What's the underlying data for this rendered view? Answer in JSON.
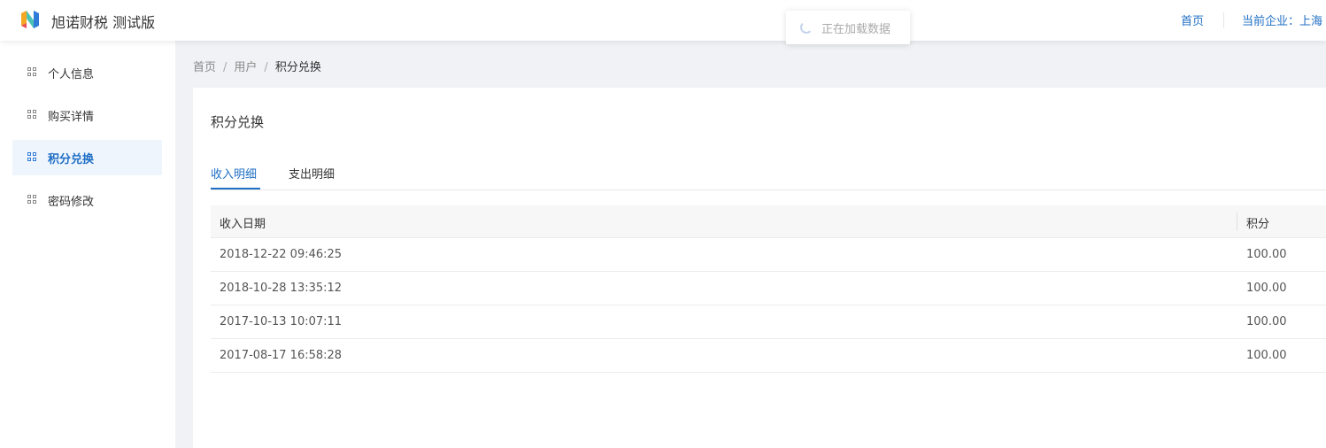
{
  "header": {
    "app_title": "旭诺财税 测试版",
    "nav_home": "首页",
    "nav_company": "当前企业：上海"
  },
  "loading": {
    "text": "正在加载数据"
  },
  "sidebar": {
    "items": [
      {
        "label": "个人信息",
        "icon": "grid-icon",
        "active": false
      },
      {
        "label": "购买详情",
        "icon": "grid-icon",
        "active": false
      },
      {
        "label": "积分兑换",
        "icon": "grid-icon",
        "active": true
      },
      {
        "label": "密码修改",
        "icon": "grid-icon",
        "active": false
      }
    ]
  },
  "breadcrumb": {
    "items": [
      "首页",
      "用户",
      "积分兑换"
    ],
    "separator": "/"
  },
  "panel": {
    "title": "积分兑换",
    "tabs": [
      {
        "label": "收入明细",
        "active": true
      },
      {
        "label": "支出明细",
        "active": false
      }
    ]
  },
  "table": {
    "headers": [
      "收入日期",
      "积分"
    ],
    "rows": [
      {
        "date": "2018-12-22 09:46:25",
        "points": "100.00"
      },
      {
        "date": "2018-10-28 13:35:12",
        "points": "100.00"
      },
      {
        "date": "2017-10-13 10:07:11",
        "points": "100.00"
      },
      {
        "date": "2017-08-17 16:58:28",
        "points": "100.00"
      }
    ]
  },
  "colors": {
    "accent": "#1f6fc5",
    "content_bg": "#f0f2f5",
    "active_item_bg": "#eef5fd"
  }
}
